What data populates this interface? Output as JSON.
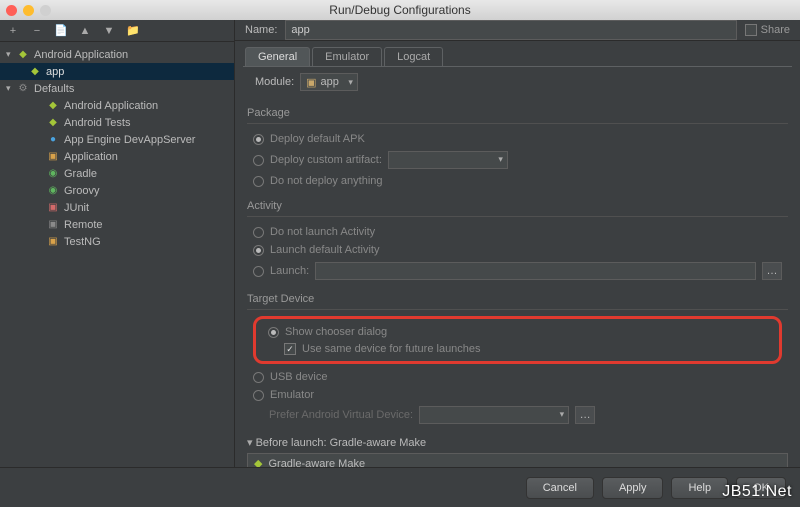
{
  "window": {
    "title": "Run/Debug Configurations"
  },
  "toolbar_icons": [
    "+",
    "−",
    "📄",
    "▲",
    "▼",
    "📁"
  ],
  "tree": {
    "root1": {
      "label": "Android Application",
      "child": "app"
    },
    "root2": {
      "label": "Defaults"
    },
    "defaults": [
      {
        "label": "Android Application",
        "icon": "icn-android"
      },
      {
        "label": "Android Tests",
        "icon": "icn-android"
      },
      {
        "label": "App Engine DevAppServer",
        "icon": "icn-blue"
      },
      {
        "label": "Application",
        "icon": "icn-orange"
      },
      {
        "label": "Gradle",
        "icon": "icn-groovy"
      },
      {
        "label": "Groovy",
        "icon": "icn-groovy"
      },
      {
        "label": "JUnit",
        "icon": "icn-red"
      },
      {
        "label": "Remote",
        "icon": "icn-grey"
      },
      {
        "label": "TestNG",
        "icon": "icn-orange"
      }
    ]
  },
  "name": {
    "label": "Name:",
    "value": "app",
    "share": "Share"
  },
  "tabs": {
    "general": "General",
    "emulator": "Emulator",
    "logcat": "Logcat"
  },
  "module": {
    "label": "Module:",
    "value": "app"
  },
  "package": {
    "title": "Package",
    "opt1": "Deploy default APK",
    "opt2": "Deploy custom artifact:",
    "opt3": "Do not deploy anything"
  },
  "activity": {
    "title": "Activity",
    "opt1": "Do not launch Activity",
    "opt2": "Launch default Activity",
    "opt3": "Launch:"
  },
  "target": {
    "title": "Target Device",
    "opt1": "Show chooser dialog",
    "check": "Use same device for future launches",
    "opt2": "USB device",
    "opt3": "Emulator",
    "avd_label": "Prefer Android Virtual Device:"
  },
  "before": {
    "title": "Before launch: Gradle-aware Make",
    "item": "Gradle-aware Make"
  },
  "buttons": {
    "cancel": "Cancel",
    "apply": "Apply",
    "help": "Help",
    "ok": "OK"
  },
  "watermark": "JB51.Net"
}
